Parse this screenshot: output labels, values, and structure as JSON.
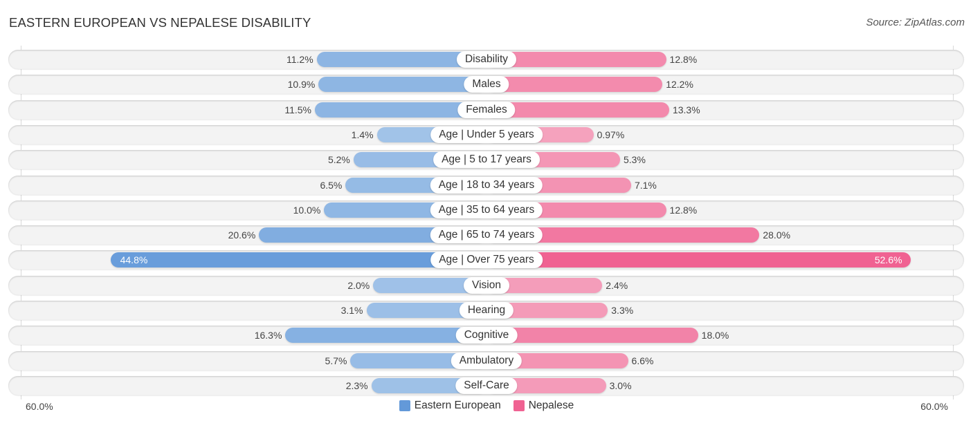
{
  "chart_data": {
    "type": "bar",
    "orientation": "horizontal-diverging",
    "title": "EASTERN EUROPEAN VS NEPALESE DISABILITY",
    "source": "Source: ZipAtlas.com",
    "categories": [
      "Disability",
      "Males",
      "Females",
      "Age | Under 5 years",
      "Age | 5 to 17 years",
      "Age | 18 to 34 years",
      "Age | 35 to 64 years",
      "Age | 65 to 74 years",
      "Age | Over 75 years",
      "Vision",
      "Hearing",
      "Cognitive",
      "Ambulatory",
      "Self-Care"
    ],
    "series": [
      {
        "name": "Eastern European",
        "color": "#6399d9",
        "light_color": "#a9c8ea",
        "side": "left",
        "values": [
          11.2,
          10.9,
          11.5,
          1.4,
          5.2,
          6.5,
          10.0,
          20.6,
          44.8,
          2.0,
          3.1,
          16.3,
          5.7,
          2.3
        ],
        "labels": [
          "11.2%",
          "10.9%",
          "11.5%",
          "1.4%",
          "5.2%",
          "6.5%",
          "10.0%",
          "20.6%",
          "44.8%",
          "2.0%",
          "3.1%",
          "16.3%",
          "5.7%",
          "2.3%"
        ]
      },
      {
        "name": "Nepalese",
        "color": "#f06292",
        "light_color": "#f5a8c1",
        "side": "right",
        "values": [
          12.8,
          12.2,
          13.3,
          0.97,
          5.3,
          7.1,
          12.8,
          28.0,
          52.6,
          2.4,
          3.3,
          18.0,
          6.6,
          3.0
        ],
        "labels": [
          "12.8%",
          "12.2%",
          "13.3%",
          "0.97%",
          "5.3%",
          "7.1%",
          "12.8%",
          "28.0%",
          "52.6%",
          "2.4%",
          "3.3%",
          "18.0%",
          "6.6%",
          "3.0%"
        ]
      }
    ],
    "xlim": [
      -60,
      60
    ],
    "axis_labels": {
      "left": "60.0%",
      "right": "60.0%"
    },
    "legend": {
      "position": "bottom-center",
      "entries": [
        "Eastern European",
        "Nepalese"
      ]
    },
    "grid": false
  }
}
